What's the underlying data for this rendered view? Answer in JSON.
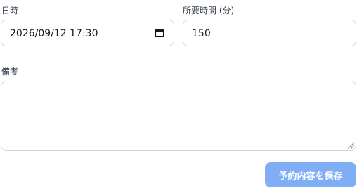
{
  "datetime": {
    "label": "日時",
    "value": "2026/09/12 17:30",
    "icon": "calendar-icon"
  },
  "duration": {
    "label": "所要時間 (分)",
    "value": "150"
  },
  "notes": {
    "label": "備考",
    "value": ""
  },
  "actions": {
    "save_label": "予約内容を保存",
    "save_color": "#7fadf6"
  }
}
